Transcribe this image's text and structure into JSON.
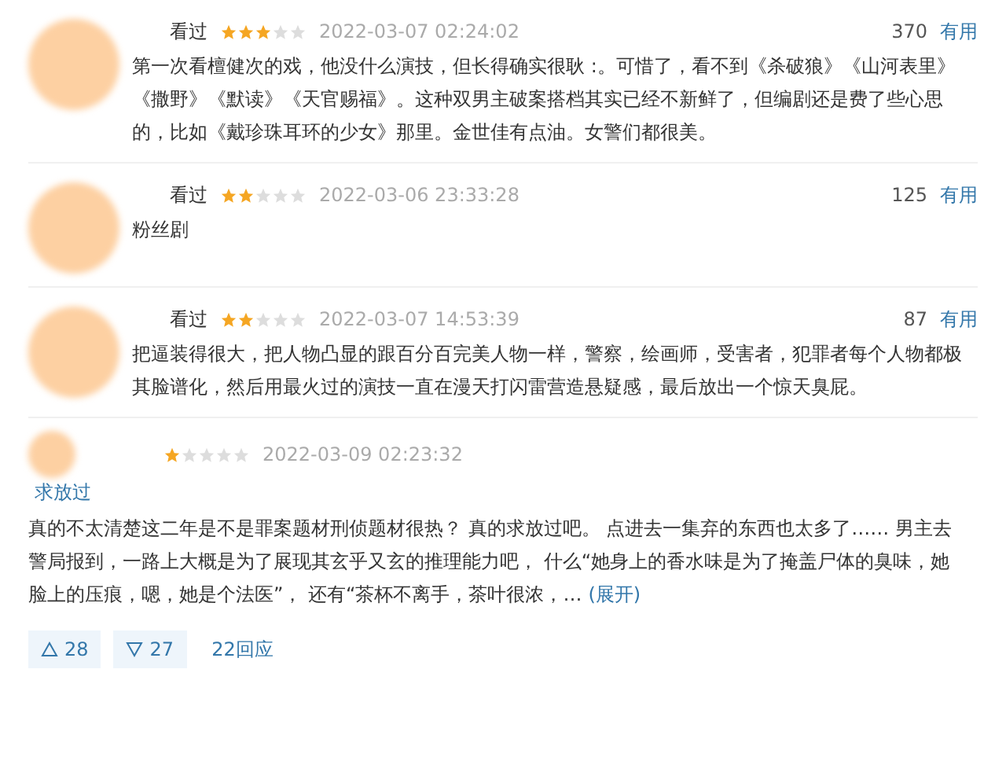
{
  "reviews": [
    {
      "status": "看过",
      "stars": 3,
      "time": "2022-03-07 02:24:02",
      "votes": "370",
      "useful": "有用",
      "text": "第一次看檀健次的戏，他没什么演技，但长得确实很耿 :。可惜了，看不到《杀破狼》《山河表里》《撒野》《默读》《天官赐福》。这种双男主破案搭档其实已经不新鲜了，但编剧还是费了些心思的，比如《戴珍珠耳环的少女》那里。金世佳有点油。女警们都很美。"
    },
    {
      "status": "看过",
      "stars": 2,
      "time": "2022-03-06 23:33:28",
      "votes": "125",
      "useful": "有用",
      "text": "粉丝剧"
    },
    {
      "status": "看过",
      "stars": 2,
      "time": "2022-03-07 14:53:39",
      "votes": "87",
      "useful": "有用",
      "text": "把逼装得很大，把人物凸显的跟百分百完美人物一样，警察，绘画师，受害者，犯罪者每个人物都极其脸谱化，然后用最火过的演技一直在漫天打闪雷营造悬疑感，最后放出一个惊天臭屁。"
    }
  ],
  "long_review": {
    "stars": 1,
    "time": "2022-03-09 02:23:32",
    "title": "求放过",
    "text": "真的不太清楚这二年是不是罪案题材刑侦题材很热？ 真的求放过吧。 点进去一集弃的东西也太多了…… 男主去警局报到，一路上大概是为了展现其玄乎又玄的推理能力吧， 什么“她身上的香水味是为了掩盖尸体的臭味，她脸上的压痕，嗯，她是个法医”， 还有“茶杯不离手，茶叶很浓，…",
    "expand": "(展开)",
    "up": "28",
    "down": "27",
    "replies": "22回应"
  }
}
